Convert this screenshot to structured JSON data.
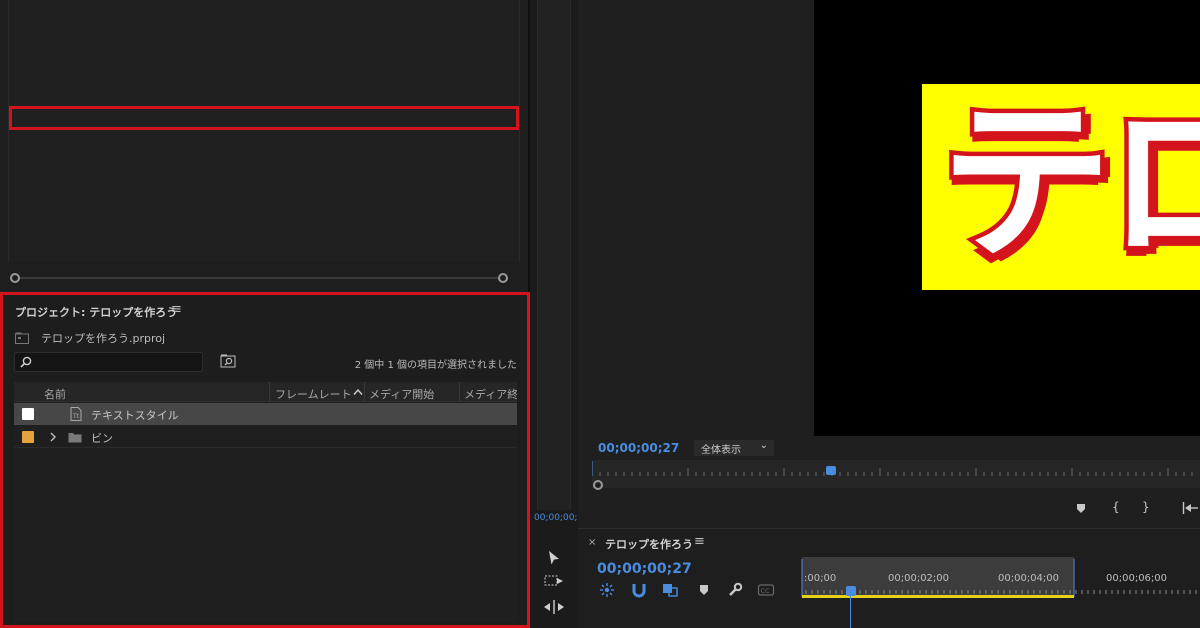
{
  "project": {
    "title": "プロジェクト: テロップを作ろう",
    "file": "テロップを作ろう.prproj",
    "search_placeholder": "",
    "selection_status": "2 個中 1 個の項目が選択されました",
    "columns": [
      "名前",
      "フレームレート",
      "メディア開始",
      "メディア終了"
    ],
    "rows": [
      {
        "label": "テキストスタイル",
        "color": "#ffffff",
        "selected": true
      },
      {
        "label": "ビン",
        "color": "#e6a23c",
        "selected": false
      }
    ]
  },
  "source": {
    "timecode": "00;00;00;"
  },
  "program": {
    "video_text": "テロ",
    "timecode": "00;00;00;27",
    "zoom": "全体表示"
  },
  "timeline": {
    "title": "テロップを作ろう",
    "timecode": "00;00;00;27",
    "ruler_labels": [
      ":00;00",
      "00;00;02;00",
      "00;00;04;00",
      "00;00;06;00"
    ]
  },
  "colors": {
    "accent": "#4a8de0",
    "highlight": "#d4141c",
    "video_bg": "#ffff00"
  }
}
